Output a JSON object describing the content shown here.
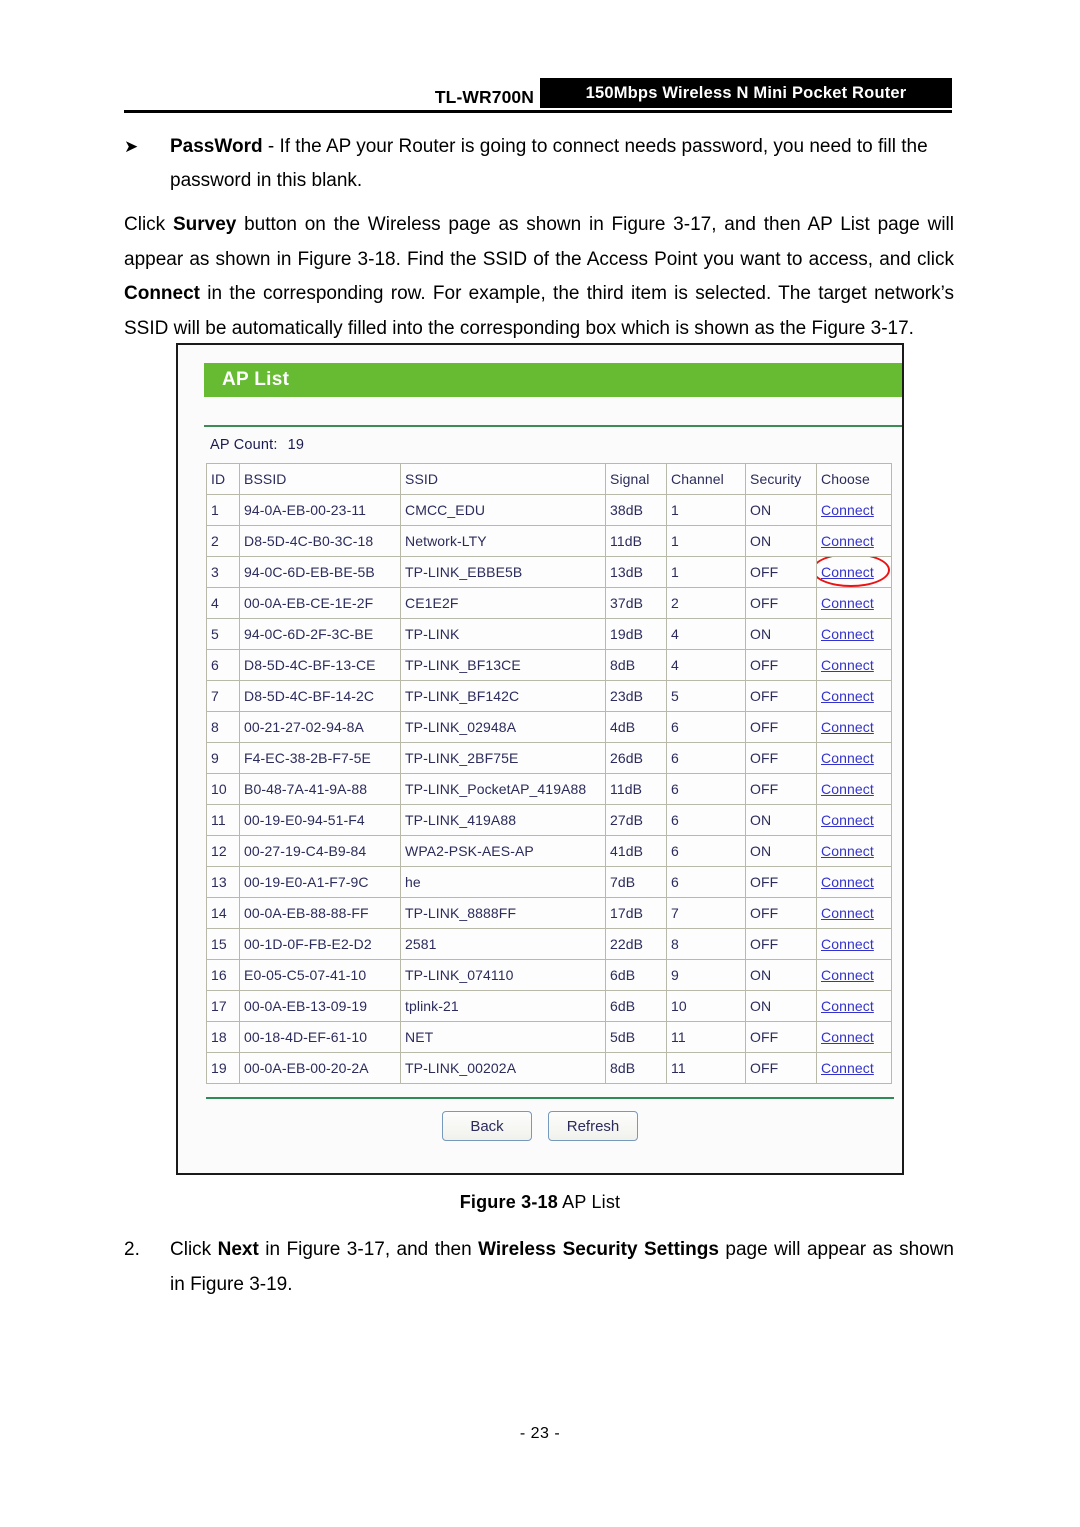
{
  "header": {
    "model": "TL-WR700N",
    "product_banner": "150Mbps Wireless N Mini Pocket Router"
  },
  "bullet": {
    "marker": "➤",
    "term": "PassWord",
    "dash": " - ",
    "line1": "If the AP your Router is going to connect needs password, you need to fill the",
    "line2": "password in this blank."
  },
  "paragraph": {
    "s1": "Click ",
    "b1": "Survey",
    "s2": " button on the Wireless page as shown in Figure 3-17, and then AP List page will appear as shown in Figure 3-18. Find the SSID of the Access Point you want to access, and click ",
    "b2": "Connect",
    "s3": " in the corresponding row. For example, the third item is selected. The target network’s SSID will be automatically filled into the corresponding box which is shown as the Figure 3-17."
  },
  "figure": {
    "panel_title": "AP List",
    "ap_count_label": "AP Count:",
    "ap_count_value": "19",
    "columns": [
      "ID",
      "BSSID",
      "SSID",
      "Signal",
      "Channel",
      "Security",
      "Choose"
    ],
    "connect_label": "Connect",
    "highlighted_row_id": 3,
    "rows": [
      {
        "id": "1",
        "bssid": "94-0A-EB-00-23-11",
        "ssid": "CMCC_EDU",
        "signal": "38dB",
        "channel": "1",
        "security": "ON"
      },
      {
        "id": "2",
        "bssid": "D8-5D-4C-B0-3C-18",
        "ssid": "Network-LTY",
        "signal": "11dB",
        "channel": "1",
        "security": "ON"
      },
      {
        "id": "3",
        "bssid": "94-0C-6D-EB-BE-5B",
        "ssid": "TP-LINK_EBBE5B",
        "signal": "13dB",
        "channel": "1",
        "security": "OFF"
      },
      {
        "id": "4",
        "bssid": "00-0A-EB-CE-1E-2F",
        "ssid": "CE1E2F",
        "signal": "37dB",
        "channel": "2",
        "security": "OFF"
      },
      {
        "id": "5",
        "bssid": "94-0C-6D-2F-3C-BE",
        "ssid": "TP-LINK",
        "signal": "19dB",
        "channel": "4",
        "security": "ON"
      },
      {
        "id": "6",
        "bssid": "D8-5D-4C-BF-13-CE",
        "ssid": "TP-LINK_BF13CE",
        "signal": "8dB",
        "channel": "4",
        "security": "OFF"
      },
      {
        "id": "7",
        "bssid": "D8-5D-4C-BF-14-2C",
        "ssid": "TP-LINK_BF142C",
        "signal": "23dB",
        "channel": "5",
        "security": "OFF"
      },
      {
        "id": "8",
        "bssid": "00-21-27-02-94-8A",
        "ssid": "TP-LINK_02948A",
        "signal": "4dB",
        "channel": "6",
        "security": "OFF"
      },
      {
        "id": "9",
        "bssid": "F4-EC-38-2B-F7-5E",
        "ssid": "TP-LINK_2BF75E",
        "signal": "26dB",
        "channel": "6",
        "security": "OFF"
      },
      {
        "id": "10",
        "bssid": "B0-48-7A-41-9A-88",
        "ssid": "TP-LINK_PocketAP_419A88",
        "signal": "11dB",
        "channel": "6",
        "security": "OFF"
      },
      {
        "id": "11",
        "bssid": "00-19-E0-94-51-F4",
        "ssid": "TP-LINK_419A88",
        "signal": "27dB",
        "channel": "6",
        "security": "ON"
      },
      {
        "id": "12",
        "bssid": "00-27-19-C4-B9-84",
        "ssid": "WPA2-PSK-AES-AP",
        "signal": "41dB",
        "channel": "6",
        "security": "ON"
      },
      {
        "id": "13",
        "bssid": "00-19-E0-A1-F7-9C",
        "ssid": "he",
        "signal": "7dB",
        "channel": "6",
        "security": "OFF"
      },
      {
        "id": "14",
        "bssid": "00-0A-EB-88-88-FF",
        "ssid": "TP-LINK_8888FF",
        "signal": "17dB",
        "channel": "7",
        "security": "OFF"
      },
      {
        "id": "15",
        "bssid": "00-1D-0F-FB-E2-D2",
        "ssid": "2581",
        "signal": "22dB",
        "channel": "8",
        "security": "OFF"
      },
      {
        "id": "16",
        "bssid": "E0-05-C5-07-41-10",
        "ssid": "TP-LINK_074110",
        "signal": "6dB",
        "channel": "9",
        "security": "ON"
      },
      {
        "id": "17",
        "bssid": "00-0A-EB-13-09-19",
        "ssid": "tplink-21",
        "signal": "6dB",
        "channel": "10",
        "security": "ON"
      },
      {
        "id": "18",
        "bssid": "00-18-4D-EF-61-10",
        "ssid": "NET",
        "signal": "5dB",
        "channel": "11",
        "security": "OFF"
      },
      {
        "id": "19",
        "bssid": "00-0A-EB-00-20-2A",
        "ssid": "TP-LINK_00202A",
        "signal": "8dB",
        "channel": "11",
        "security": "OFF"
      }
    ],
    "buttons": {
      "back": "Back",
      "refresh": "Refresh"
    },
    "caption_num": "Figure 3-18",
    "caption_title": " AP List"
  },
  "step": {
    "number": "2.",
    "s1": "Click ",
    "b1": "Next",
    "s2": " in Figure 3-17, and then ",
    "b2": "Wireless Security Settings",
    "s3": " page will appear as shown in Figure 3-19."
  },
  "footer": {
    "page_number": "- 23 -"
  },
  "colors": {
    "panel_green": "#66bb33",
    "separator_green": "#2e8b57",
    "link_blue": "#3333cc",
    "highlight_red": "#ee1111",
    "table_text": "#2b2b5c"
  }
}
